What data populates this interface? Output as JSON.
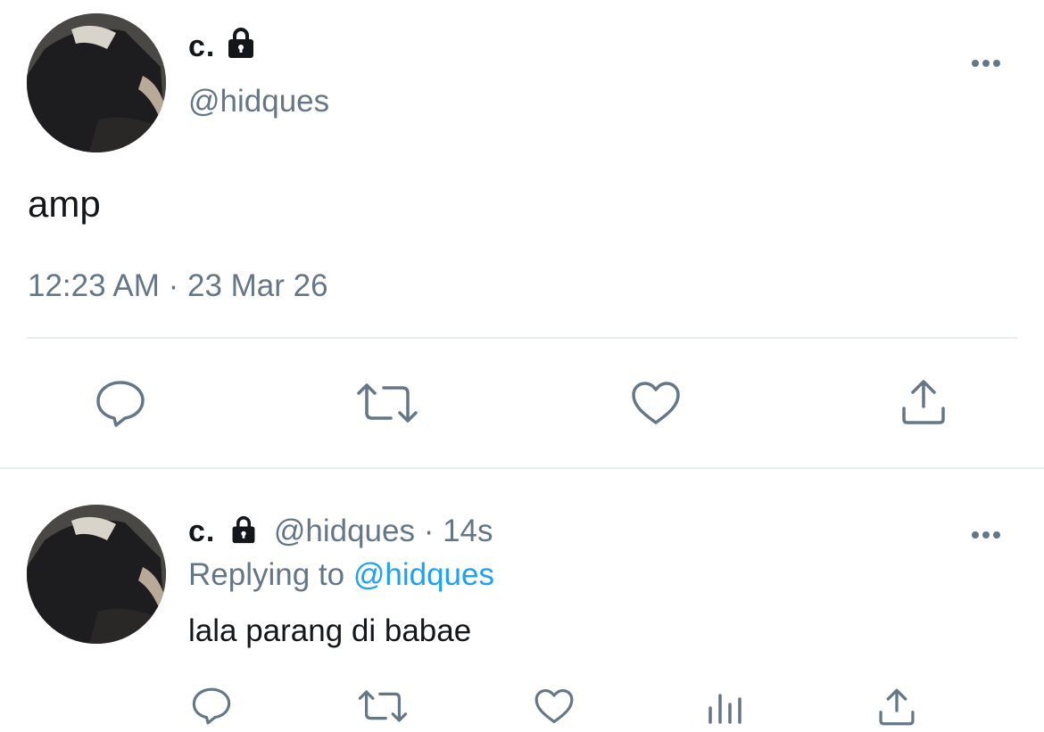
{
  "tweet": {
    "author_name": "c.",
    "author_handle": "@hidques",
    "text": "amp",
    "timestamp": "12:23 AM · 23 Mar 26"
  },
  "reply": {
    "author_name": "c.",
    "author_handle": "@hidques",
    "separator": "·",
    "age": "14s",
    "replying_to_label": "Replying to",
    "replying_to_handle": "@hidques",
    "text": "lala parang di babae"
  },
  "colors": {
    "secondary_text": "#657786",
    "link": "#1da1f2",
    "divider": "#e6ecf0"
  },
  "icons": {
    "tweet_actions": [
      "reply-icon",
      "retweet-icon",
      "like-icon",
      "share-icon"
    ],
    "reply_actions": [
      "reply-icon",
      "retweet-icon",
      "like-icon",
      "analytics-icon",
      "share-icon"
    ]
  }
}
